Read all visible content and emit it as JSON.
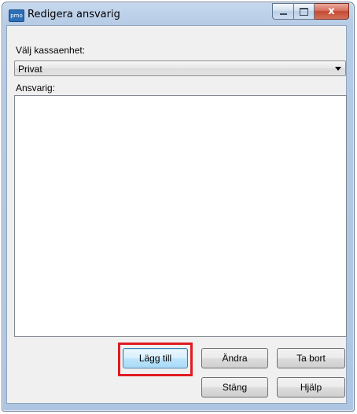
{
  "window": {
    "title": "Redigera ansvarig",
    "app_icon_text": "pmo",
    "controls": {
      "minimize": "minimize",
      "maximize": "maximize",
      "close": "x"
    }
  },
  "form": {
    "unit_label": "Välj kassaenhet:",
    "unit_selected": "Privat",
    "responsible_label": "Ansvarig:",
    "responsible_items": []
  },
  "buttons": {
    "add": "Lägg till",
    "edit": "Ändra",
    "remove": "Ta bort",
    "close": "Stäng",
    "help": "Hjälp"
  },
  "colors": {
    "highlight": "#e01b22",
    "title_bar": "#b6cbe4",
    "close_button": "#c54a32"
  }
}
